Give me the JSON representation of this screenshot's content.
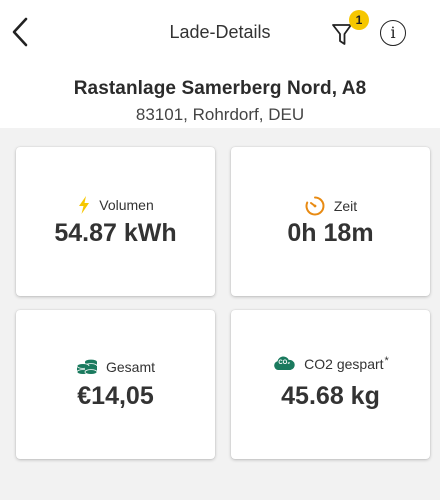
{
  "header": {
    "title": "Lade-Details",
    "filter_badge": "1",
    "info_symbol": "i"
  },
  "location": {
    "name": "Rastanlage Samerberg Nord, A8",
    "address": "83101, Rohrdorf, DEU"
  },
  "stats": {
    "volume": {
      "label": "Volumen",
      "value": "54.87 kWh",
      "icon": "lightning-icon"
    },
    "time": {
      "label": "Zeit",
      "value": "0h 18m",
      "icon": "timer-icon"
    },
    "total": {
      "label": "Gesamt",
      "value": "€14,05",
      "icon": "coins-icon"
    },
    "co2": {
      "label": "CO2 gespart",
      "footnote": "*",
      "value": "45.68 kg",
      "icon": "co2-cloud-icon",
      "icon_text": "CO₂"
    }
  },
  "colors": {
    "accent": "#f6c700",
    "green": "#1a7a5e",
    "orange": "#e88a12",
    "background": "#f2f2f2"
  }
}
